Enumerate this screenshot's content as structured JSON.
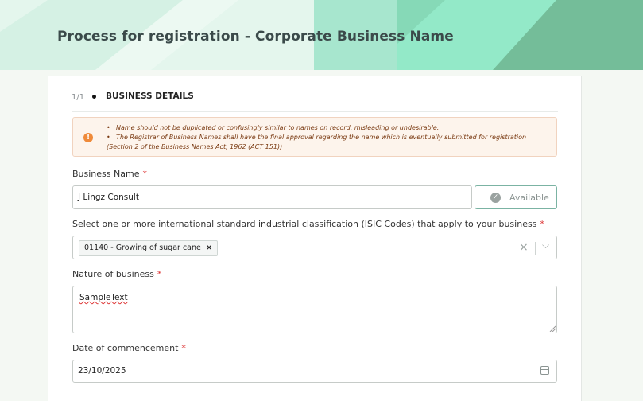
{
  "header": {
    "title": "Process for registration - Corporate Business Name"
  },
  "stepper": {
    "step": "1/1",
    "label": "BUSINESS DETAILS"
  },
  "notice": {
    "icon": "warning-icon",
    "items": [
      "Name should not be duplicated or confusingly similar to names on record, misleading or undesirable.",
      "The Registrar of Business Names shall have the final approval regarding the name which is eventually submitted for registration (Section 2 of the Business Names Act, 1962 (ACT 151))"
    ]
  },
  "form": {
    "business_name": {
      "label": "Business Name",
      "required": "*",
      "value": "J Lingz Consult"
    },
    "availability": {
      "label": "Available",
      "icon": "check-circle-icon"
    },
    "isic": {
      "label": "Select one or more international standard industrial classification (ISIC Codes) that apply to your business",
      "required": "*",
      "selected": [
        "01140 - Growing of sugar cane"
      ],
      "clear_icon": "clear-icon",
      "dropdown_icon": "chevron-down-icon"
    },
    "nature": {
      "label": "Nature of business",
      "required": "*",
      "value": "SampleText"
    },
    "date": {
      "label": "Date of commencement",
      "required": "*",
      "value": "23/10/2025",
      "icon": "calendar-icon"
    }
  },
  "colors": {
    "accent": "#7bb3a3",
    "banner_light": "#e6f6ee",
    "banner_mid": "#92e8c6",
    "banner_dark": "#72bd98",
    "required": "#dd3333"
  }
}
